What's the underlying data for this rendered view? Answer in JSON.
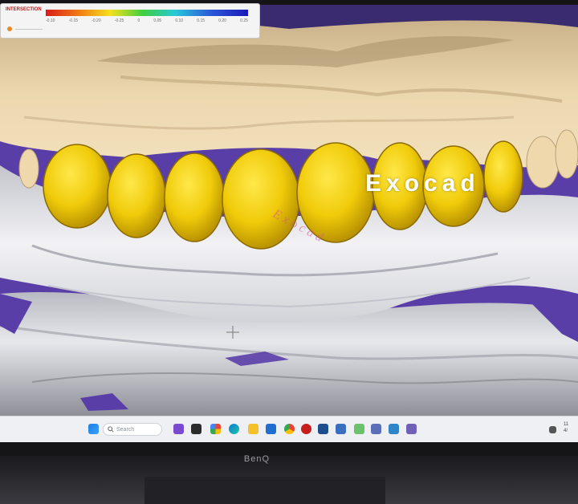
{
  "legend": {
    "title": "INTERSECTION",
    "ticks": [
      "-0.10",
      "-0.15",
      "-0.20",
      "-0.25",
      "0",
      "0.05",
      "0.10",
      "0.15",
      "0.20",
      "0.25"
    ],
    "colors": [
      "#d81b1b",
      "#f07a12",
      "#f5e020",
      "#3fcf3f",
      "#27c8d8",
      "#2b57d8",
      "#1a1ab8"
    ]
  },
  "scene": {
    "upper_model_color": "#e8d2a8",
    "lower_model_color": "#e9eaee",
    "crown_color": "#f2cf0c",
    "background_color": "#5a3ea8"
  },
  "watermark": {
    "text": "Exocad",
    "faint_text": "Exocad"
  },
  "taskbar": {
    "search_placeholder": "Search",
    "icons": [
      "windows-start-icon",
      "search-icon",
      "widgets-icon",
      "file-explorer-icon",
      "browser-icon",
      "folder-icon",
      "mail-icon",
      "store-icon",
      "chrome-icon",
      "record-icon",
      "app-icon-1",
      "app-icon-2",
      "app-icon-3",
      "app-icon-4",
      "app-icon-5",
      "app-icon-6"
    ],
    "clock": {
      "time": "11",
      "date": "4/"
    }
  },
  "monitor": {
    "brand": "BenQ"
  }
}
